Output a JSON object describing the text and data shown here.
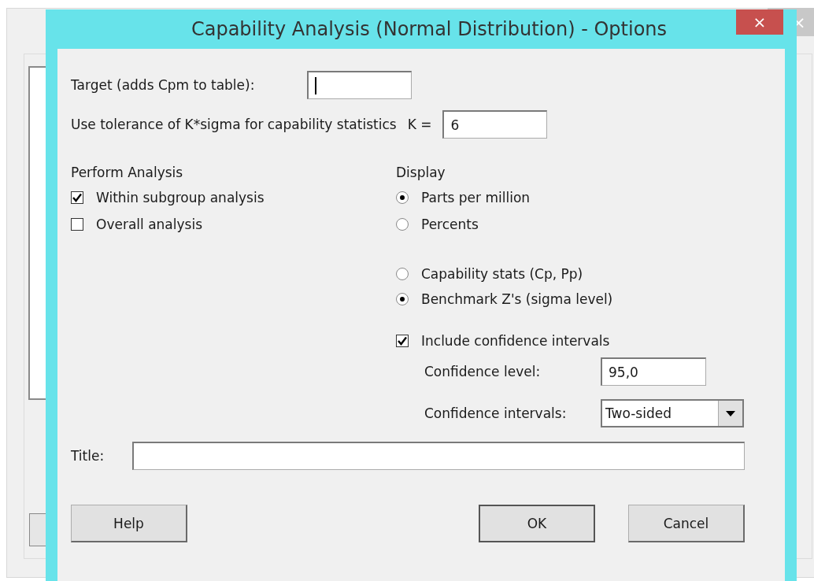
{
  "background_window": {
    "close": "×"
  },
  "window": {
    "title": "Capability Analysis (Normal Distribution) - Options",
    "close": "×"
  },
  "target": {
    "label": "Target (adds Cpm to table):",
    "focused": true
  },
  "tolerance": {
    "label": "Use tolerance of K*sigma for capability statistics",
    "k_label": "K =",
    "value": "6"
  },
  "perform_analysis": {
    "heading": "Perform Analysis",
    "options": [
      {
        "label": "Within subgroup analysis",
        "checked": true
      },
      {
        "label": "Overall analysis",
        "checked": false
      }
    ]
  },
  "display": {
    "heading": "Display",
    "units": [
      {
        "label": "Parts per million",
        "selected": true
      },
      {
        "label": "Percents",
        "selected": false
      }
    ],
    "stats": [
      {
        "label": "Capability stats (Cp, Pp)",
        "selected": false
      },
      {
        "label": "Benchmark Z's (sigma level)",
        "selected": true
      }
    ],
    "confidence": {
      "label": "Include confidence intervals",
      "checked": true,
      "level_label": "Confidence level:",
      "level_value": "95,0",
      "intervals_label": "Confidence intervals:",
      "intervals_value": "Two-sided"
    }
  },
  "title_field": {
    "label": "Title:"
  },
  "buttons": [
    {
      "label": "Help",
      "default": false
    },
    {
      "label": "OK",
      "default": true
    },
    {
      "label": "Cancel",
      "default": false
    }
  ]
}
